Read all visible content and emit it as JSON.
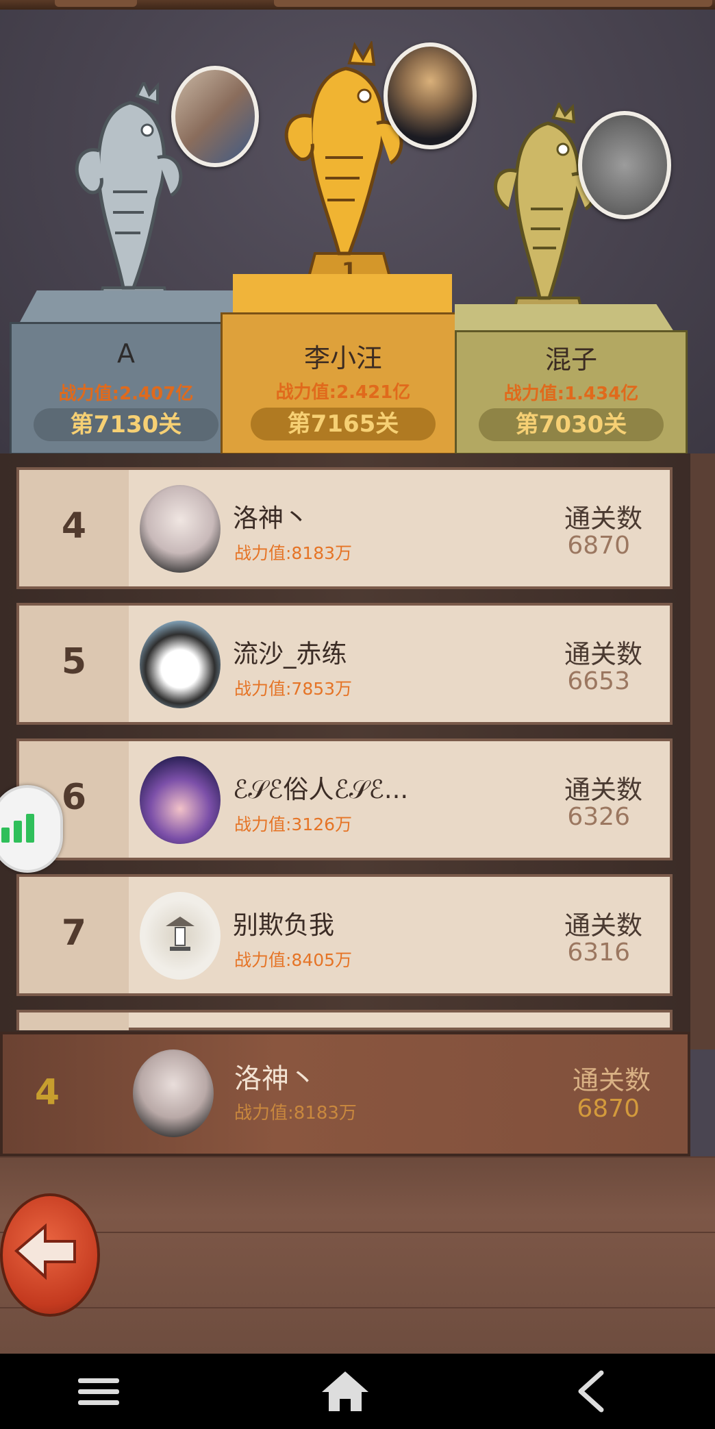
{
  "podium": [
    {
      "place": "2",
      "name": "A",
      "power": "战力值:2.407亿",
      "level": "第7130关"
    },
    {
      "place": "1",
      "name": "李小汪",
      "power": "战力值:2.421亿",
      "level": "第7165关"
    },
    {
      "place": "3",
      "name": "混子",
      "power": "战力值:1.434亿",
      "level": "第7030关"
    }
  ],
  "rows": [
    {
      "rank": "4",
      "name": "洛神丶",
      "power": "战力值:8183万",
      "label": "通关数",
      "count": "6870"
    },
    {
      "rank": "5",
      "name": "流沙_赤练",
      "power": "战力值:7853万",
      "label": "通关数",
      "count": "6653"
    },
    {
      "rank": "6",
      "name": "ℰ𝒮ℰ俗人ℰ𝒮ℰ...",
      "power": "战力值:3126万",
      "label": "通关数",
      "count": "6326"
    },
    {
      "rank": "7",
      "name": "别欺负我",
      "power": "战力值:8405万",
      "label": "通关数",
      "count": "6316"
    }
  ],
  "me": {
    "rank": "4",
    "name": "洛神丶",
    "power": "战力值:8183万",
    "label": "通关数",
    "count": "6870"
  },
  "colors": {
    "gold": "#e8b53b",
    "silver": "#9aa6ae",
    "bronze": "#b9a55a",
    "power": "#e06a1c",
    "accent_red": "#d9472a"
  },
  "icons": {
    "back": "arrow-left-icon",
    "menu": "menu-icon",
    "home": "home-icon",
    "nav_back": "chevron-left-icon",
    "stats": "bar-chart-icon"
  }
}
